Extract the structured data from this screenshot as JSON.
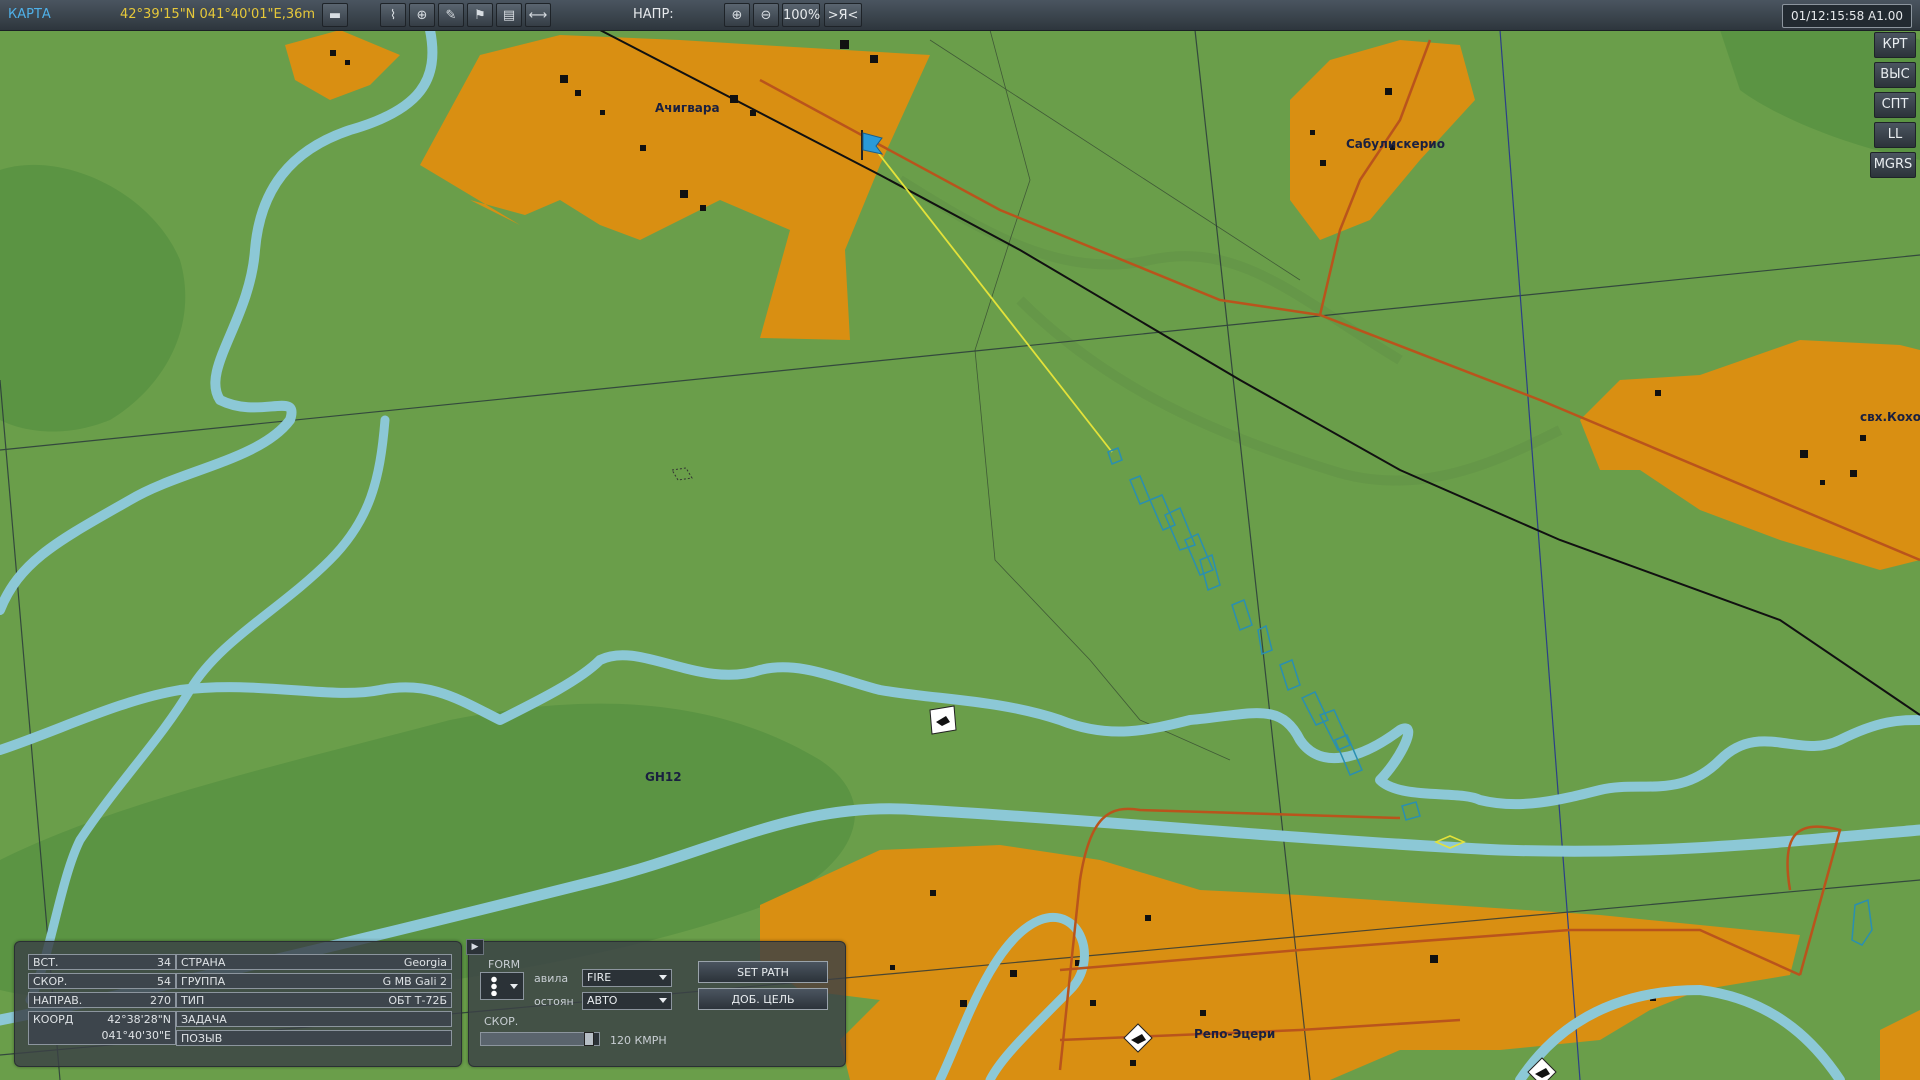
{
  "topbar": {
    "mode": "КАРТА",
    "coords": "42°39'15\"N 041°40'01\"E,36m",
    "heading_label": "НАПР:",
    "zoom": "100%",
    "center_me": ">Я<",
    "clock": "01/12:15:58 A1.00"
  },
  "sidebar": {
    "items": [
      {
        "label": "КРТ"
      },
      {
        "label": "ВЫС"
      },
      {
        "label": "СПТ"
      },
      {
        "label": "LL"
      },
      {
        "label": "MGRS"
      }
    ]
  },
  "map": {
    "towns": [
      {
        "name": "Ачигвара"
      },
      {
        "name": "Сабулискерио"
      },
      {
        "name": "свх.Кохора"
      },
      {
        "name": "Репо-Эцери"
      }
    ],
    "grid_label": "GH12",
    "colors": {
      "terrain": "#6a9e4a",
      "forest": "#5b9443",
      "town": "#d98f12",
      "river": "#8cc8d6",
      "road": "#b9541c",
      "rail": "#111111",
      "route": "#e3e23a",
      "unit": "#2a8fb0"
    }
  },
  "unit_info": {
    "altitude": {
      "label": "ВСТ.",
      "value": "34"
    },
    "speed": {
      "label": "СКОР.",
      "value": "54"
    },
    "heading": {
      "label": "НАПРАВ.",
      "value": "270"
    },
    "coords": {
      "label": "КООРД",
      "lat": "42°38'28\"N",
      "lon": "041°40'30\"E"
    },
    "country": {
      "label": "СТРАНА",
      "value": "Georgia"
    },
    "group": {
      "label": "ГРУППА",
      "value": "G MB Gali 2"
    },
    "type": {
      "label": "ТИП",
      "value": "ОБТ Т-72Б"
    },
    "task": {
      "label": "ЗАДАЧА",
      "value": ""
    },
    "callsign": {
      "label": "ПОЗЫВ",
      "value": ""
    }
  },
  "orders": {
    "form_label": "FORM",
    "roe_label": "авила",
    "roe_value": "FIRE",
    "alarm_label": "остоян",
    "alarm_value": "АВТО",
    "speed_label": "СКОР.",
    "speed_value": "120 КМРН",
    "speed_fraction": 0.95,
    "set_path": "SET PATH",
    "add_target": "ДОБ. ЦЕЛЬ"
  }
}
